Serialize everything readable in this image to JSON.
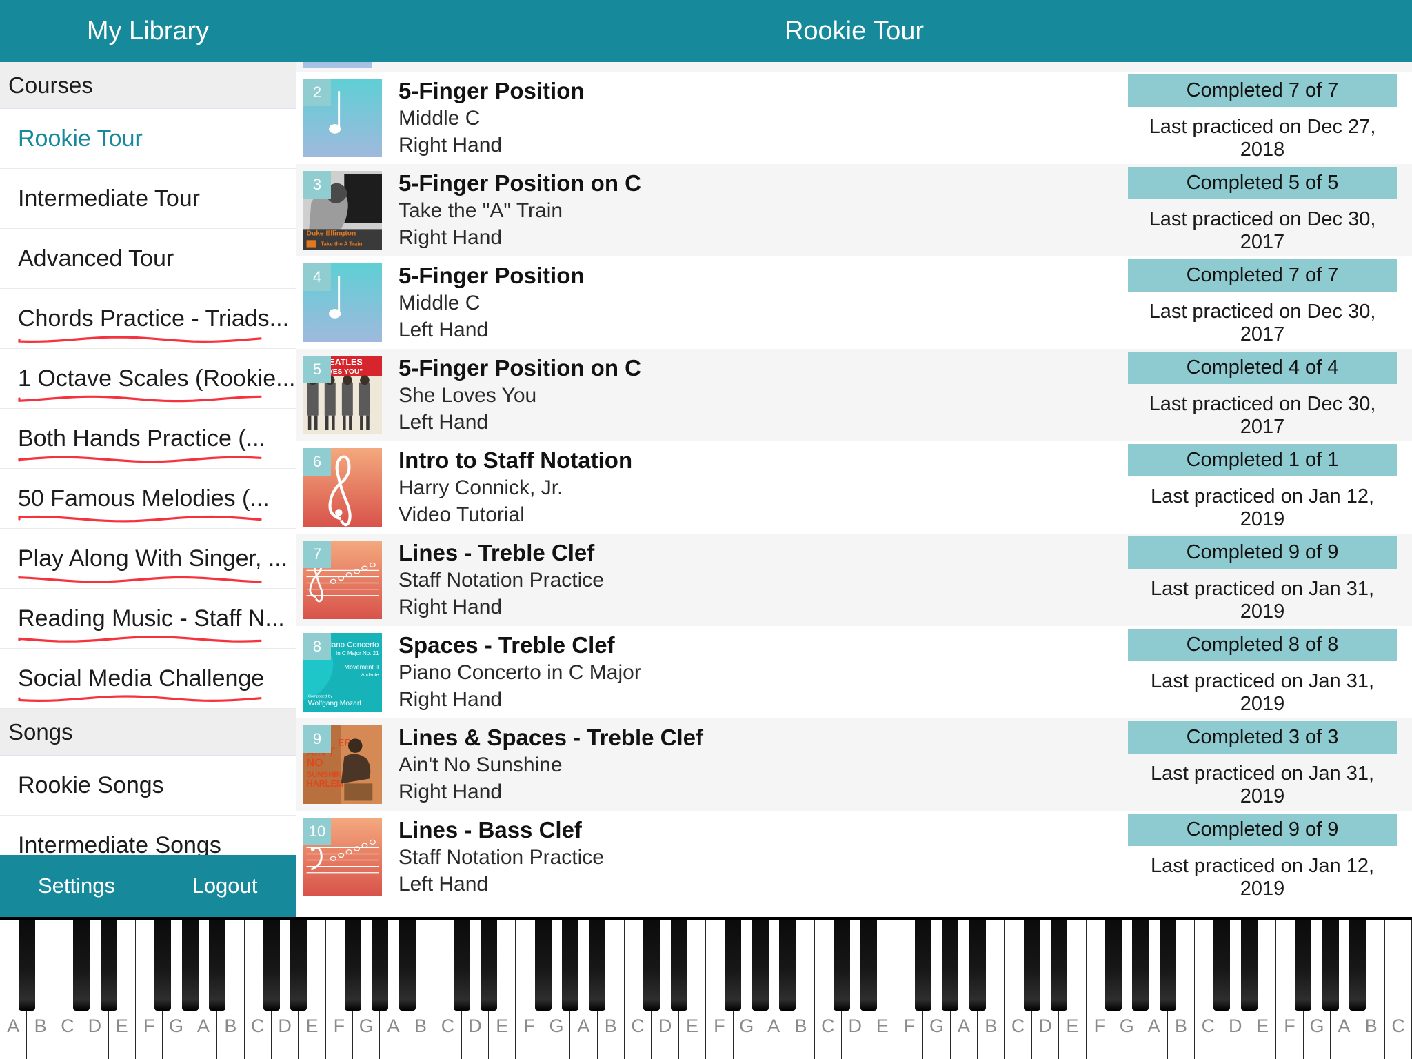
{
  "sidebar": {
    "header_title": "My Library",
    "sections": [
      {
        "label": "Courses",
        "items": [
          {
            "label": "Rookie Tour",
            "active": true,
            "annotated": false
          },
          {
            "label": "Intermediate Tour",
            "active": false,
            "annotated": false
          },
          {
            "label": "Advanced Tour",
            "active": false,
            "annotated": false
          },
          {
            "label": "Chords Practice - Triads...",
            "active": false,
            "annotated": true
          },
          {
            "label": "1 Octave Scales (Rookie...",
            "active": false,
            "annotated": true
          },
          {
            "label": "Both Hands Practice (...",
            "active": false,
            "annotated": true
          },
          {
            "label": "50 Famous Melodies (...",
            "active": false,
            "annotated": true
          },
          {
            "label": "Play Along With Singer, ...",
            "active": false,
            "annotated": true
          },
          {
            "label": "Reading Music - Staff N...",
            "active": false,
            "annotated": true
          },
          {
            "label": "Social Media Challenge",
            "active": false,
            "annotated": true
          }
        ]
      },
      {
        "label": "Songs",
        "items": [
          {
            "label": "Rookie Songs",
            "active": false,
            "annotated": false
          },
          {
            "label": "Intermediate Songs",
            "active": false,
            "annotated": false
          }
        ]
      }
    ],
    "footer": {
      "settings_label": "Settings",
      "logout_label": "Logout"
    }
  },
  "main": {
    "header_title": "Rookie Tour",
    "lessons": [
      {
        "number": "2",
        "title": "5-Finger Position",
        "subtitle": "Middle C",
        "hand": "Right Hand",
        "completed": "Completed 7 of 7",
        "practiced": "Last practiced on Dec 27, 2018",
        "art": "note-blue"
      },
      {
        "number": "3",
        "title": "5-Finger Position on C",
        "subtitle": "Take the \"A\" Train",
        "hand": "Right Hand",
        "completed": "Completed 5 of 5",
        "practiced": "Last practiced on Dec 30, 2017",
        "art": "ellington"
      },
      {
        "number": "4",
        "title": "5-Finger Position",
        "subtitle": "Middle C",
        "hand": "Left Hand",
        "completed": "Completed 7 of 7",
        "practiced": "Last practiced on Dec 30, 2017",
        "art": "note-blue"
      },
      {
        "number": "5",
        "title": "5-Finger Position on C",
        "subtitle": "She Loves You",
        "hand": "Left Hand",
        "completed": "Completed 4 of 4",
        "practiced": "Last practiced on Dec 30, 2017",
        "art": "beatles"
      },
      {
        "number": "6",
        "title": "Intro to Staff Notation",
        "subtitle": "Harry Connick, Jr.",
        "hand": "Video Tutorial",
        "completed": "Completed 1 of 1",
        "practiced": "Last practiced on Jan 12, 2019",
        "art": "treble-red"
      },
      {
        "number": "7",
        "title": "Lines - Treble Clef",
        "subtitle": "Staff Notation Practice",
        "hand": "Right Hand",
        "completed": "Completed 9 of 9",
        "practiced": "Last practiced on Jan 31, 2019",
        "art": "staff-treble"
      },
      {
        "number": "8",
        "title": "Spaces - Treble Clef",
        "subtitle": "Piano Concerto in C Major",
        "hand": "Right Hand",
        "completed": "Completed 8 of 8",
        "practiced": "Last practiced on Jan 31, 2019",
        "art": "mozart"
      },
      {
        "number": "9",
        "title": "Lines & Spaces - Treble Clef",
        "subtitle": "Ain't No Sunshine",
        "hand": "Right Hand",
        "completed": "Completed 3 of 3",
        "practiced": "Last practiced on Jan 31, 2019",
        "art": "withers"
      },
      {
        "number": "10",
        "title": "Lines - Bass Clef",
        "subtitle": "Staff Notation Practice",
        "hand": "Left Hand",
        "completed": "Completed 9 of 9",
        "practiced": "Last practiced on Jan 12, 2019",
        "art": "staff-bass"
      }
    ]
  },
  "piano": {
    "white_key_labels": [
      "A",
      "B",
      "C",
      "D",
      "E",
      "F",
      "G",
      "A",
      "B",
      "C",
      "D",
      "E",
      "F",
      "G",
      "A",
      "B",
      "C",
      "D",
      "E",
      "F",
      "G",
      "A",
      "B",
      "C",
      "D",
      "E",
      "F",
      "G",
      "A",
      "B",
      "C",
      "D",
      "E",
      "F",
      "G",
      "A",
      "B",
      "C",
      "D",
      "E",
      "F",
      "G",
      "A",
      "B",
      "C",
      "D",
      "E",
      "F",
      "G",
      "A",
      "B",
      "C"
    ]
  },
  "colors": {
    "brand_teal": "#16899a",
    "badge_teal": "#8ecbd0",
    "active_link": "#17899a",
    "annotation_red": "#f5333f",
    "row_alt": "#f5f5f5"
  }
}
